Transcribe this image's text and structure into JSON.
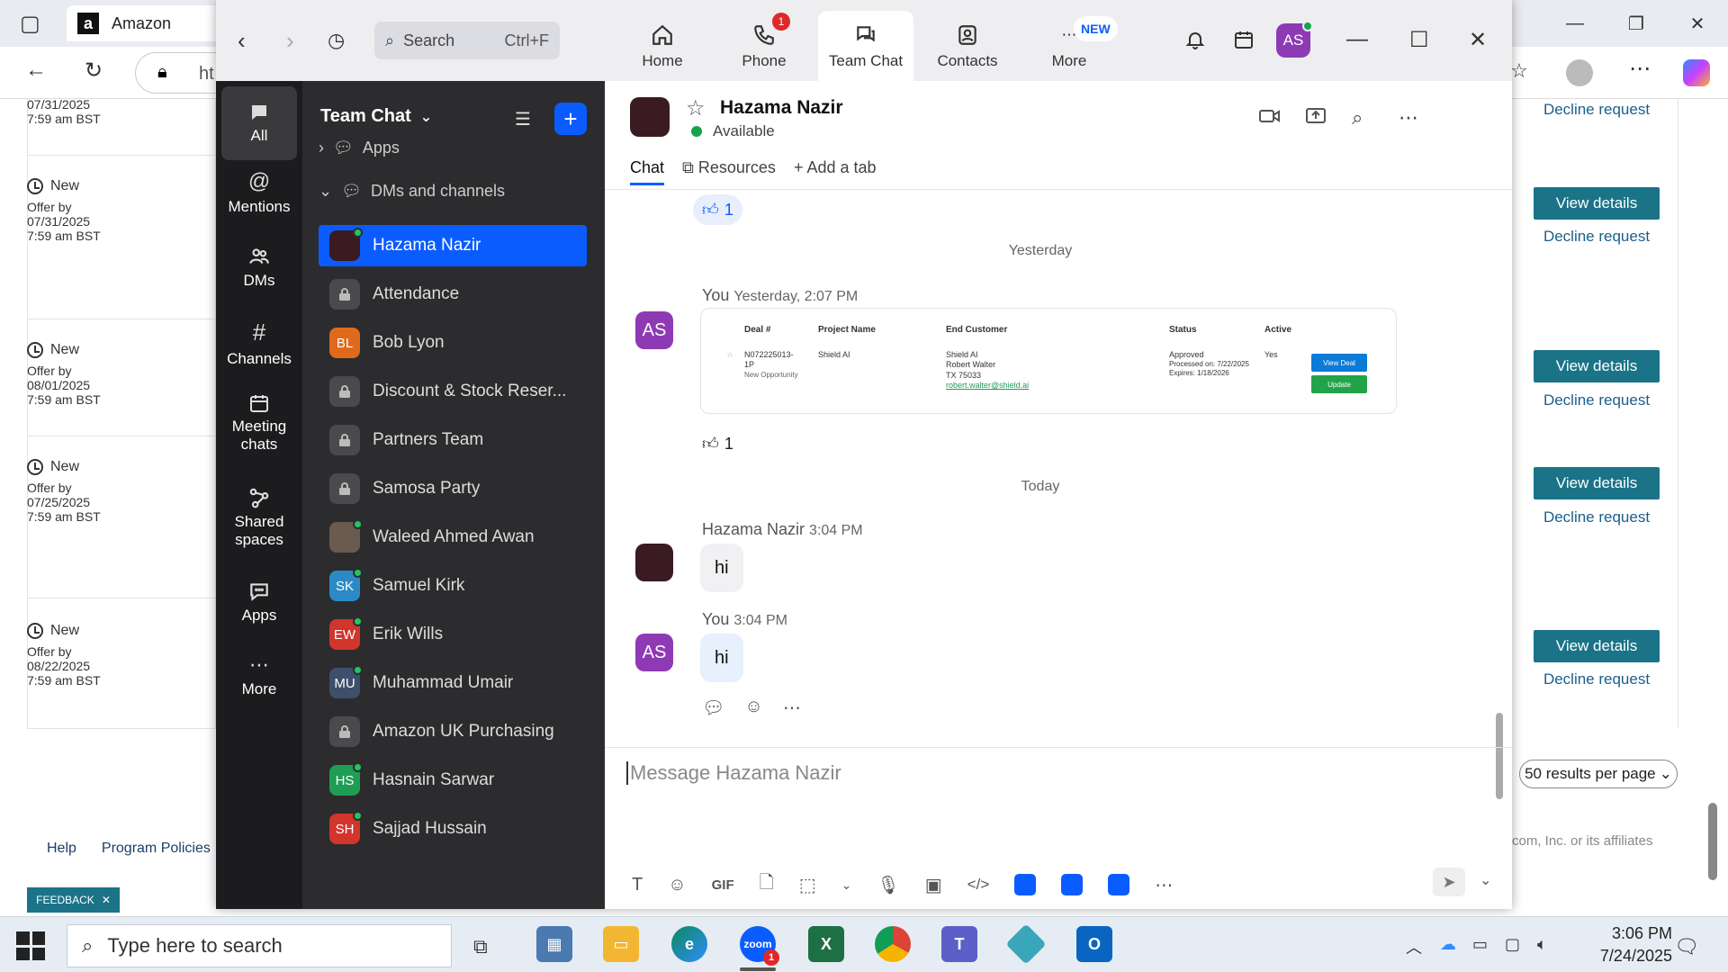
{
  "browser": {
    "tab_title": "Amazon",
    "url_fragment": "ht",
    "requests": [
      {
        "status": "",
        "label": "",
        "date": "07/31/2025",
        "time": "7:59 am BST"
      },
      {
        "status": "New",
        "label": "Offer by",
        "date": "07/31/2025",
        "time": "7:59 am BST"
      },
      {
        "status": "New",
        "label": "Offer by",
        "date": "08/01/2025",
        "time": "7:59 am BST"
      },
      {
        "status": "New",
        "label": "Offer by",
        "date": "07/25/2025",
        "time": "7:59 am BST"
      },
      {
        "status": "New",
        "label": "Offer by",
        "date": "08/22/2025",
        "time": "7:59 am BST"
      }
    ],
    "view_details_label": "View details",
    "decline_label": "Decline request",
    "per_page": "50 results per page",
    "copyright": "com, Inc. or its affiliates",
    "footer_links": [
      "Help",
      "Program Policies"
    ],
    "feedback": "FEEDBACK"
  },
  "zoom": {
    "search_placeholder": "Search",
    "search_shortcut": "Ctrl+F",
    "tabs": [
      {
        "label": "Home",
        "icon": "home-icon"
      },
      {
        "label": "Phone",
        "icon": "phone-icon",
        "badge": "1"
      },
      {
        "label": "Team Chat",
        "icon": "chat-icon"
      },
      {
        "label": "Contacts",
        "icon": "contacts-icon"
      },
      {
        "label": "More",
        "icon": "more-icon",
        "badge": "NEW"
      }
    ],
    "user_initials": "AS",
    "rail": [
      {
        "label": "All"
      },
      {
        "label": "Mentions"
      },
      {
        "label": "DMs"
      },
      {
        "label": "Channels"
      },
      {
        "label": "Meeting chats"
      },
      {
        "label": "Shared spaces"
      },
      {
        "label": "Apps"
      },
      {
        "label": "More"
      }
    ],
    "channel_list": {
      "title": "Team Chat",
      "apps_section": "Apps",
      "dm_section": "DMs and channels",
      "items": [
        {
          "name": "Hazama Nazir",
          "initials": "",
          "color": "#3b1b22",
          "online": true
        },
        {
          "name": "Attendance",
          "locked": true
        },
        {
          "name": "Bob Lyon",
          "initials": "BL",
          "color": "#e06a1b",
          "online": false
        },
        {
          "name": "Discount & Stock Reser...",
          "locked": true
        },
        {
          "name": "Partners Team",
          "locked": true
        },
        {
          "name": "Samosa Party",
          "locked": true
        },
        {
          "name": "Waleed Ahmed Awan",
          "initials": "",
          "color": "#6b5a4e",
          "online": true
        },
        {
          "name": "Samuel Kirk",
          "initials": "SK",
          "color": "#2b8ac6",
          "online": true
        },
        {
          "name": "Erik Wills",
          "initials": "EW",
          "color": "#d2352c",
          "online": true
        },
        {
          "name": "Muhammad Umair",
          "initials": "MU",
          "color": "#3d4f6a",
          "online": true
        },
        {
          "name": "Amazon UK Purchasing",
          "locked": true
        },
        {
          "name": "Hasnain Sarwar",
          "initials": "HS",
          "color": "#1f9d55",
          "online": true
        },
        {
          "name": "Sajjad Hussain",
          "initials": "SH",
          "color": "#d2352c",
          "online": true
        }
      ]
    },
    "chat": {
      "contact_name": "Hazama Nazir",
      "contact_status": "Available",
      "tabs": [
        "Chat",
        "Resources",
        "Add a tab"
      ],
      "reaction_top": "1",
      "day_yesterday": "Yesterday",
      "msg1_sender": "You",
      "msg1_time": "Yesterday, 2:07 PM",
      "deal_card": {
        "headers": [
          "Deal #",
          "Project Name",
          "End Customer",
          "Status",
          "Active"
        ],
        "deal_no": "N072225013-1P",
        "deal_type": "New Opportunity",
        "project": "Shield AI",
        "customer_lines": [
          "Shield AI",
          "Robert Walter",
          "TX 75033"
        ],
        "customer_email": "robert.walter@shield.ai",
        "status": "Approved",
        "processed": "Processed on: 7/22/2025",
        "expires": "Expires: 1/18/2026",
        "active": "Yes",
        "btn_view": "View Deal",
        "btn_update": "Update"
      },
      "reaction_card": "1",
      "day_today": "Today",
      "msg2_sender": "Hazama Nazir",
      "msg2_time": "3:04 PM",
      "msg2_text": "hi",
      "msg3_sender": "You",
      "msg3_time": "3:04 PM",
      "msg3_text": "hi",
      "composer_placeholder": "Message Hazama Nazir"
    }
  },
  "taskbar": {
    "search_placeholder": "Type here to search",
    "time": "3:06 PM",
    "date": "7/24/2025",
    "zoom_badge": "1"
  }
}
